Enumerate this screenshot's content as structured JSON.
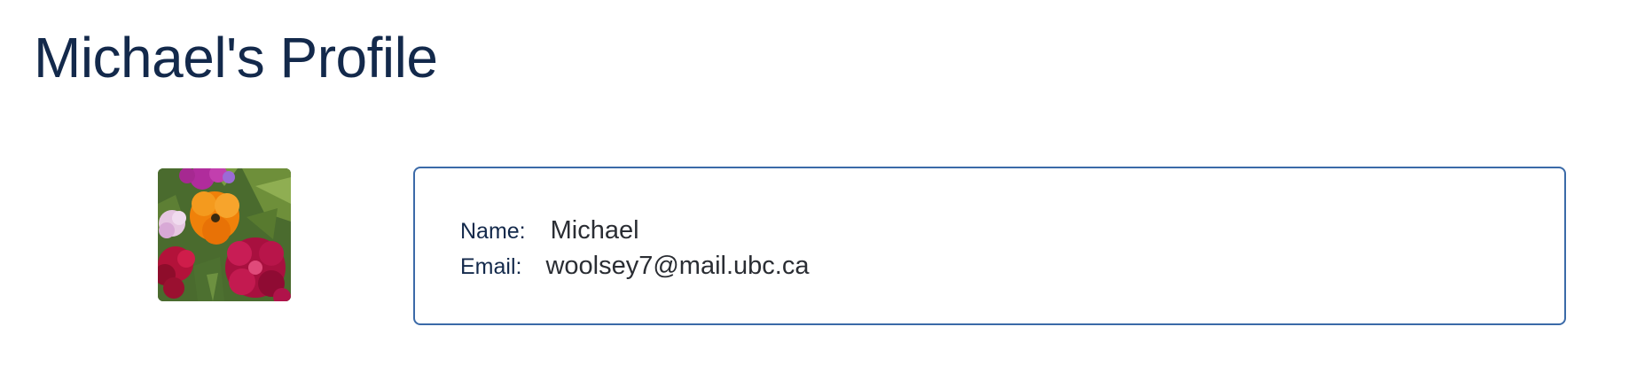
{
  "page": {
    "title": "Michael's Profile"
  },
  "profile": {
    "avatar_icon": "profile-photo-flowers",
    "name_label": "Name:",
    "name_value": "Michael",
    "email_label": "Email:",
    "email_value": "woolsey7@mail.ubc.ca"
  },
  "colors": {
    "title": "#13294b",
    "card_border": "#3b6aa8",
    "background": "#ffffff"
  }
}
